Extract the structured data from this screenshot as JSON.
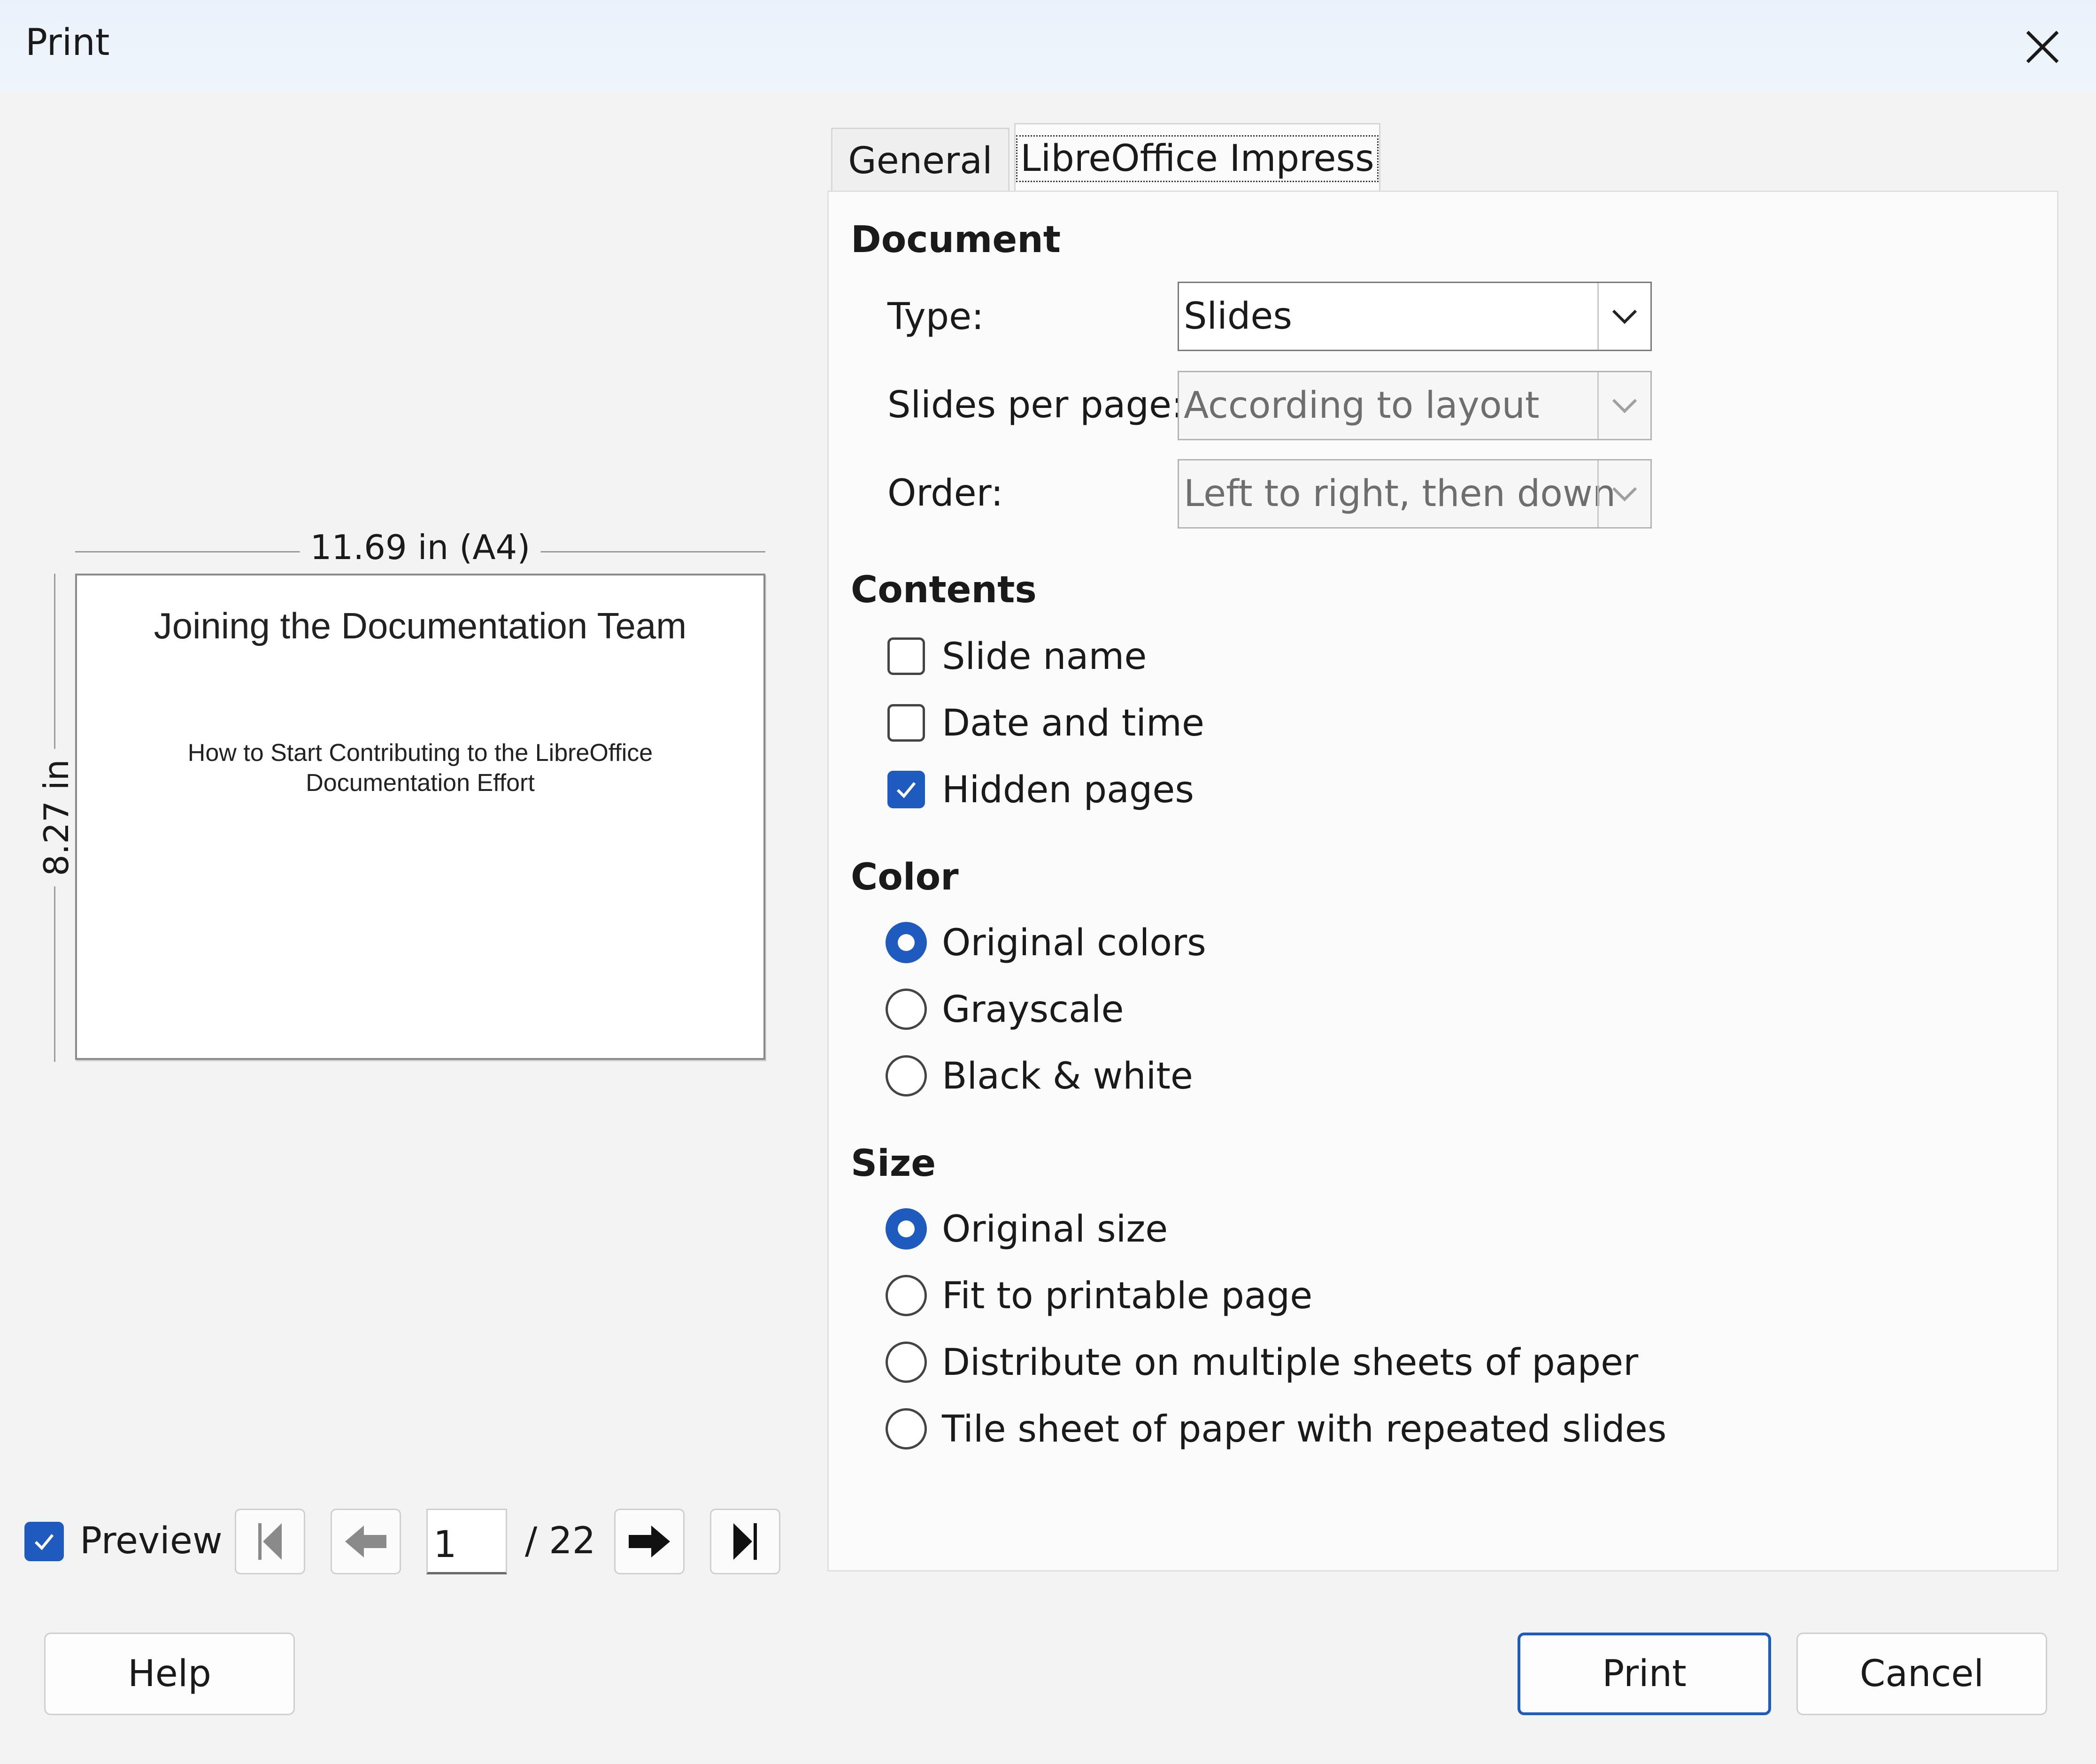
{
  "window": {
    "title": "Print"
  },
  "preview": {
    "width_label": "11.69 in (A4)",
    "height_label": "8.27 in",
    "slide_title": "Joining the Documentation Team",
    "slide_subtitle": "How to Start Contributing to the LibreOffice Documentation Effort",
    "preview_checkbox_label": "Preview",
    "preview_checked": true,
    "current_page": "1",
    "total_pages": "/ 22"
  },
  "tabs": [
    {
      "label": "General",
      "active": false
    },
    {
      "label": "LibreOffice Impress",
      "active": true
    }
  ],
  "document": {
    "heading": "Document",
    "type_label": "Type:",
    "type_value": "Slides",
    "slides_per_page_label": "Slides per page:",
    "slides_per_page_value": "According to layout",
    "order_label": "Order:",
    "order_value": "Left to right, then down"
  },
  "contents": {
    "heading": "Contents",
    "options": [
      {
        "label": "Slide name",
        "checked": false
      },
      {
        "label": "Date and time",
        "checked": false
      },
      {
        "label": "Hidden pages",
        "checked": true
      }
    ]
  },
  "color": {
    "heading": "Color",
    "options": [
      {
        "label": "Original colors",
        "selected": true
      },
      {
        "label": "Grayscale",
        "selected": false
      },
      {
        "label": "Black & white",
        "selected": false
      }
    ]
  },
  "size": {
    "heading": "Size",
    "options": [
      {
        "label": "Original size",
        "selected": true
      },
      {
        "label": "Fit to printable page",
        "selected": false
      },
      {
        "label": "Distribute on multiple sheets of paper",
        "selected": false
      },
      {
        "label": "Tile sheet of paper with repeated slides",
        "selected": false
      }
    ]
  },
  "buttons": {
    "help": "Help",
    "print": "Print",
    "cancel": "Cancel"
  },
  "colors": {
    "accent": "#1f5bbf",
    "dialog_bg": "#f3f3f3",
    "titlebar_bg": "#e9f2fb"
  }
}
